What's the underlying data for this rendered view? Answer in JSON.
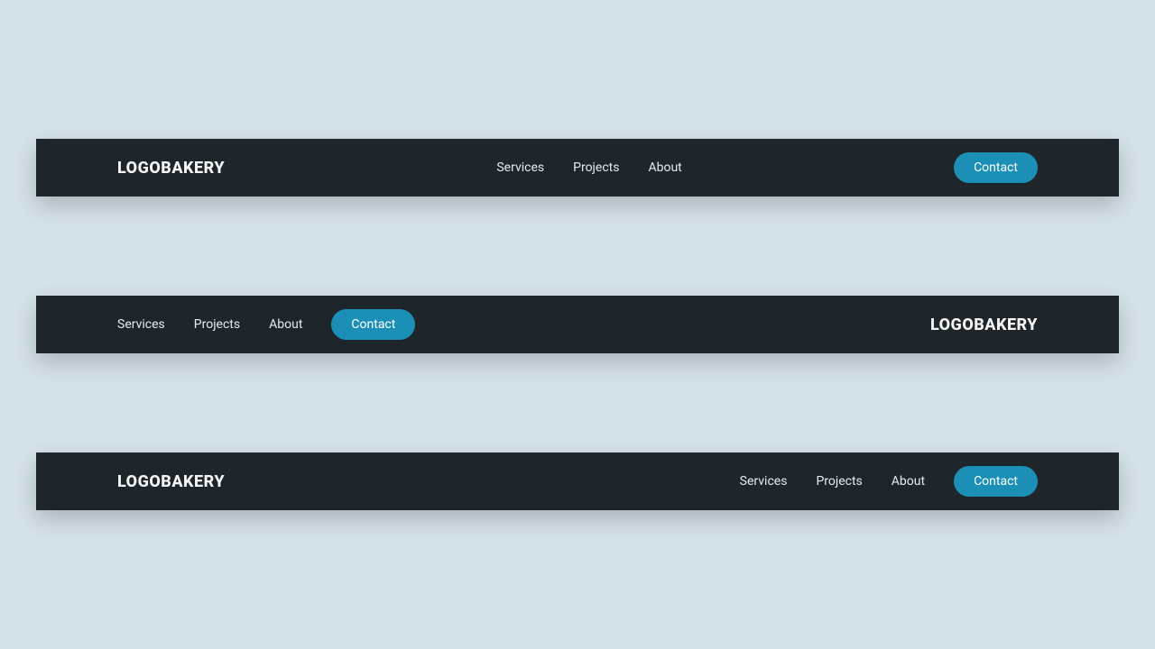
{
  "brand": "LOGOBAKERY",
  "nav": {
    "services": "Services",
    "projects": "Projects",
    "about": "About",
    "contact": "Contact"
  }
}
